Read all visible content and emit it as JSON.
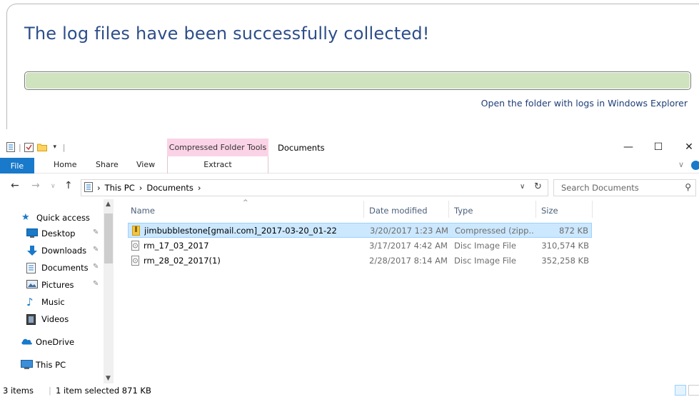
{
  "collector": {
    "title": "The log files have been successfully collected!",
    "progress_fraction": 1.0,
    "progress_color": "#cfe3bf",
    "open_folder_link": "Open the folder with logs in Windows Explorer"
  },
  "explorer": {
    "context_tab_title": "Compressed Folder Tools",
    "window_title": "Documents",
    "window_buttons": {
      "minimize": "—",
      "maximize": "☐",
      "close": "✕"
    },
    "ribbon_tabs": {
      "file": "File",
      "home": "Home",
      "share": "Share",
      "view": "View",
      "extract": "Extract"
    },
    "accent_color": "#1979ca",
    "breadcrumb": {
      "root": "This PC",
      "current": "Documents"
    },
    "search_placeholder": "Search Documents",
    "nav": {
      "quick_access": "Quick access",
      "items": [
        {
          "label": "Desktop",
          "icon": "desktop-icon",
          "pinned": true
        },
        {
          "label": "Downloads",
          "icon": "downloads-icon",
          "pinned": true
        },
        {
          "label": "Documents",
          "icon": "documents-icon",
          "pinned": true
        },
        {
          "label": "Pictures",
          "icon": "pictures-icon",
          "pinned": true
        },
        {
          "label": "Music",
          "icon": "music-icon",
          "pinned": false
        },
        {
          "label": "Videos",
          "icon": "videos-icon",
          "pinned": false
        }
      ],
      "onedrive": "OneDrive",
      "this_pc": "This PC"
    },
    "columns": {
      "name": "Name",
      "date": "Date modified",
      "type": "Type",
      "size": "Size"
    },
    "files": [
      {
        "name": "jimbubblestone[gmail.com]_2017-03-20_01-22",
        "date": "3/20/2017 1:23 AM",
        "type": "Compressed (zipp...",
        "size": "872 KB",
        "selected": true,
        "icon": "zip-folder-icon"
      },
      {
        "name": "rm_17_03_2017",
        "date": "3/17/2017 4:42 AM",
        "type": "Disc Image File",
        "size": "310,574 KB",
        "selected": false,
        "icon": "disc-image-icon"
      },
      {
        "name": "rm_28_02_2017(1)",
        "date": "2/28/2017 8:14 AM",
        "type": "Disc Image File",
        "size": "352,258 KB",
        "selected": false,
        "icon": "disc-image-icon"
      }
    ],
    "status": {
      "items": "3 items",
      "selected": "1 item selected  871 KB"
    }
  }
}
